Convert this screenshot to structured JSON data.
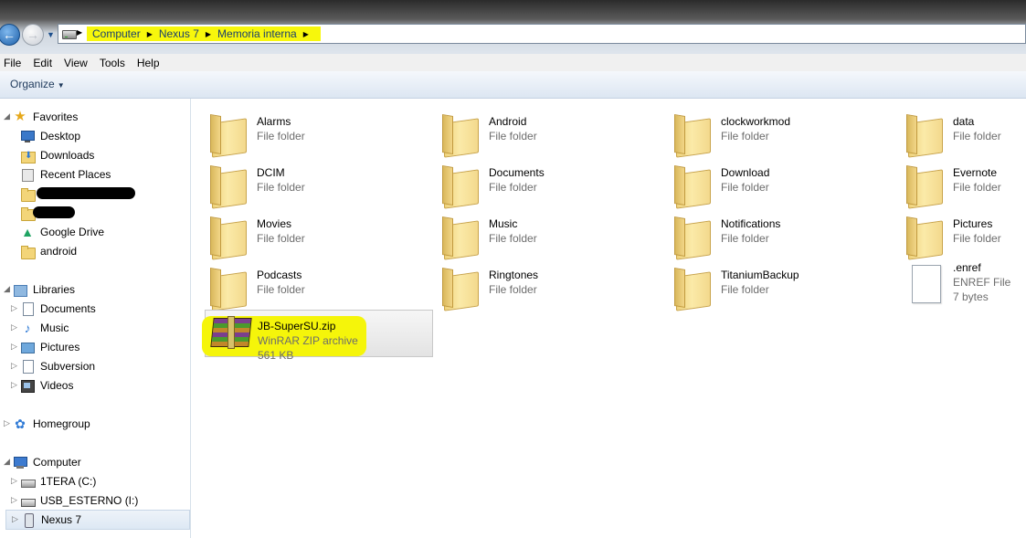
{
  "address_bar": {
    "crumbs": [
      "Computer",
      "Nexus 7",
      "Memoria interna"
    ],
    "highlight_color": "#f7f70c"
  },
  "menu": [
    "File",
    "Edit",
    "View",
    "Tools",
    "Help"
  ],
  "toolbar": {
    "organize_label": "Organize"
  },
  "navigation": {
    "favorites": {
      "label": "Favorites",
      "items": [
        "Desktop",
        "Downloads",
        "Recent Places",
        "Google Drive",
        "android"
      ]
    },
    "libraries": {
      "label": "Libraries",
      "items": [
        "Documents",
        "Music",
        "Pictures",
        "Subversion",
        "Videos"
      ]
    },
    "homegroup": {
      "label": "Homegroup"
    },
    "computer": {
      "label": "Computer",
      "items": [
        "1TERA (C:)",
        "USB_ESTERNO (I:)",
        "Nexus 7"
      ],
      "selected": "Nexus 7"
    }
  },
  "files": [
    {
      "name": "Alarms",
      "type": "File folder",
      "icon": "folder-icon"
    },
    {
      "name": "Android",
      "type": "File folder",
      "icon": "folder-icon"
    },
    {
      "name": "clockworkmod",
      "type": "File folder",
      "icon": "folder-icon"
    },
    {
      "name": "data",
      "type": "File folder",
      "icon": "folder-icon"
    },
    {
      "name": "DCIM",
      "type": "File folder",
      "icon": "folder-icon"
    },
    {
      "name": "Documents",
      "type": "File folder",
      "icon": "folder-icon"
    },
    {
      "name": "Download",
      "type": "File folder",
      "icon": "folder-icon"
    },
    {
      "name": "Evernote",
      "type": "File folder",
      "icon": "folder-icon"
    },
    {
      "name": "Movies",
      "type": "File folder",
      "icon": "folder-icon"
    },
    {
      "name": "Music",
      "type": "File folder",
      "icon": "folder-icon"
    },
    {
      "name": "Notifications",
      "type": "File folder",
      "icon": "folder-icon"
    },
    {
      "name": "Pictures",
      "type": "File folder",
      "icon": "folder-icon"
    },
    {
      "name": "Podcasts",
      "type": "File folder",
      "icon": "folder-icon"
    },
    {
      "name": "Ringtones",
      "type": "File folder",
      "icon": "folder-icon"
    },
    {
      "name": "TitaniumBackup",
      "type": "File folder",
      "icon": "folder-icon"
    },
    {
      "name": ".enref",
      "type": "ENREF File",
      "size": "7 bytes",
      "icon": "file-icon"
    },
    {
      "name": "JB-SuperSU.zip",
      "type": "WinRAR ZIP archive",
      "size": "561 KB",
      "icon": "winrar-archive-icon",
      "selected": true
    }
  ]
}
